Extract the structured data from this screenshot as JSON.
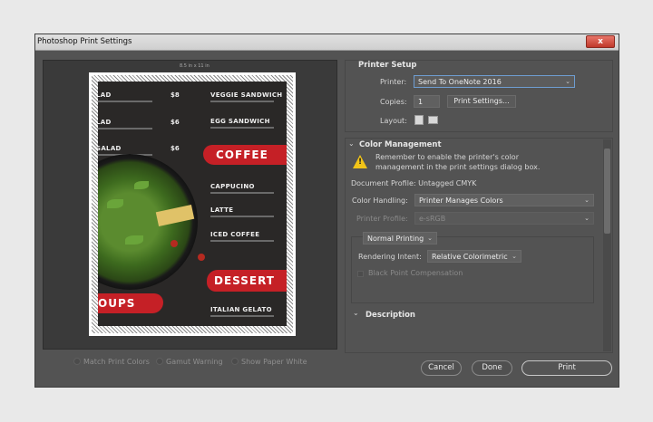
{
  "window": {
    "title": "Photoshop Print Settings",
    "close": "x"
  },
  "preview": {
    "size_label": "8.5 in x 11 in",
    "menu": {
      "items": [
        {
          "name": "VEGGIE SANDWICH",
          "price": "$8"
        },
        {
          "name": "EGG SANDWICH",
          "price": "$6"
        },
        {
          "name": "CAPPUCINO"
        },
        {
          "name": "LATTE"
        },
        {
          "name": "ICED COFFEE"
        },
        {
          "name": "ITALIAN GELATO"
        }
      ],
      "left_items": [
        "LAD",
        "SALAD"
      ],
      "left_price3": "$6",
      "banner_coffee": "COFFEE",
      "banner_dessert": "DESSERT",
      "banner_soups": "OUPS"
    }
  },
  "preview_options": {
    "match_print_colors": "Match Print Colors",
    "gamut_warning": "Gamut Warning",
    "show_paper_white": "Show Paper White"
  },
  "printer_setup": {
    "title": "Printer Setup",
    "printer_label": "Printer:",
    "printer_value": "Send To OneNote 2016",
    "copies_label": "Copies:",
    "copies_value": "1",
    "print_settings_btn": "Print Settings...",
    "layout_label": "Layout:"
  },
  "color_management": {
    "title": "Color Management",
    "warning_line1": "Remember to enable the printer's color",
    "warning_line2": "management in the print settings dialog box.",
    "document_profile": "Document Profile: Untagged CMYK",
    "color_handling_label": "Color Handling:",
    "color_handling_value": "Printer Manages Colors",
    "printer_profile_label": "Printer Profile:",
    "printer_profile_value": "e-sRGB",
    "printing_mode": "Normal Printing",
    "rendering_intent_label": "Rendering Intent:",
    "rendering_intent_value": "Relative Colorimetric",
    "black_point": "Black Point Compensation"
  },
  "description": {
    "title": "Description"
  },
  "buttons": {
    "cancel": "Cancel",
    "done": "Done",
    "print": "Print"
  }
}
